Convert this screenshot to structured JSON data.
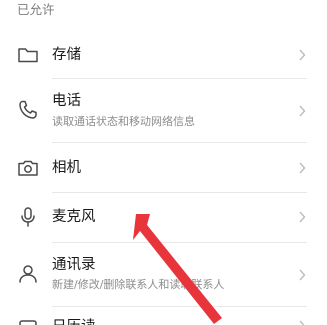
{
  "section": {
    "header": "已允许"
  },
  "permissions": [
    {
      "title": "存储",
      "subtitle": "",
      "icon": "folder-icon"
    },
    {
      "title": "电话",
      "subtitle": "读取通话状态和移动网络信息",
      "icon": "phone-icon"
    },
    {
      "title": "相机",
      "subtitle": "",
      "icon": "camera-icon"
    },
    {
      "title": "麦克风",
      "subtitle": "",
      "icon": "microphone-icon"
    },
    {
      "title": "通讯录",
      "subtitle": "新建/修改/删除联系人和读取联系人",
      "icon": "contacts-icon"
    },
    {
      "title": "日历读",
      "subtitle": "",
      "icon": "calendar-icon"
    }
  ],
  "colors": {
    "annotation_arrow": "#e8353b",
    "divider": "#e8e8e8",
    "icon": "#4a4a4a",
    "chevron": "#bdbdbd"
  }
}
